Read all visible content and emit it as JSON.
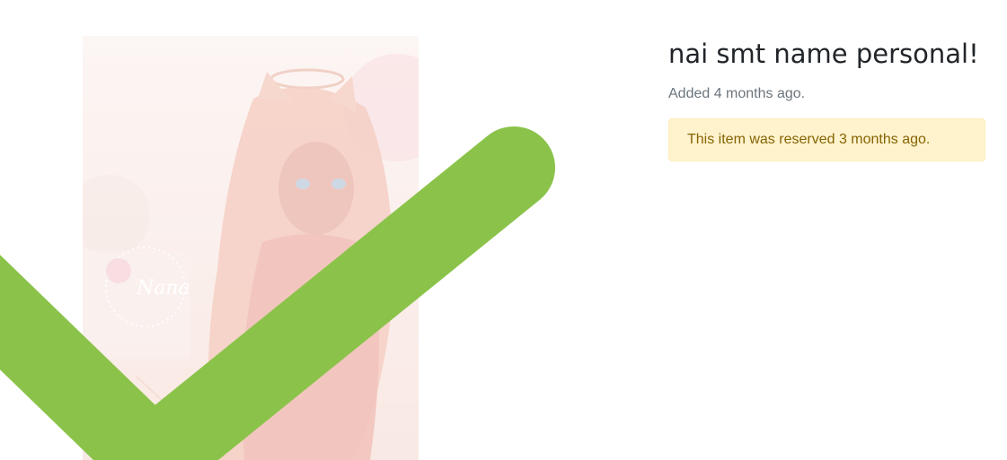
{
  "item": {
    "title": "nai smt name personal!",
    "added_text": "Added 4 months ago.",
    "reserved_notice": "This item was reserved 3 months ago.",
    "image": {
      "watermark_text": "Nana",
      "description_icon": "avatar-illustration"
    }
  },
  "colors": {
    "check_green": "#8bc34a",
    "alert_bg": "#fff3cd",
    "alert_text": "#856404",
    "muted_text": "#6c757d"
  }
}
